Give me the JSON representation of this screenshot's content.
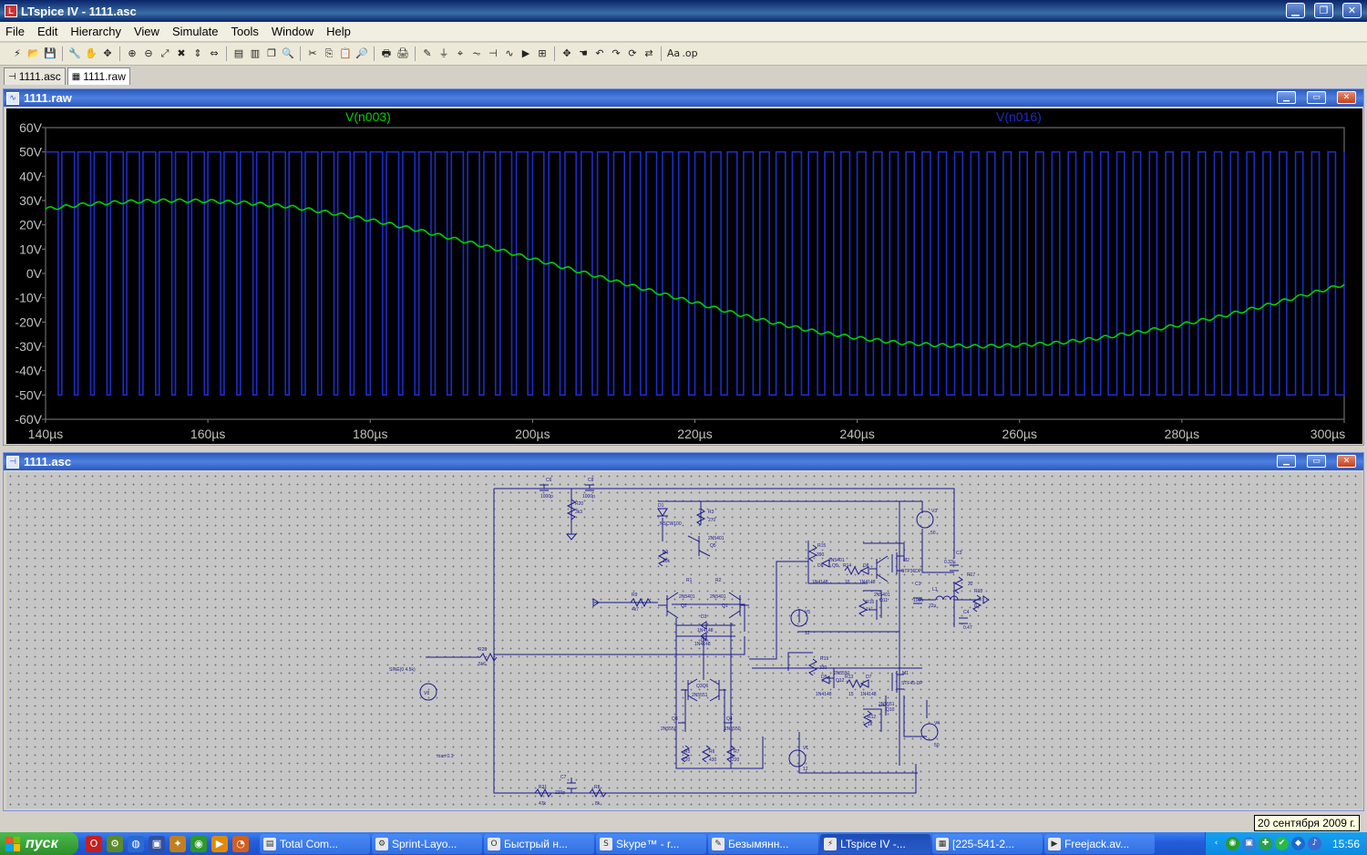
{
  "window": {
    "title": "LTspice IV - 1111.asc",
    "minimize": "▁",
    "restore": "❐",
    "close": "✕"
  },
  "menu": [
    "File",
    "Edit",
    "Hierarchy",
    "View",
    "Simulate",
    "Tools",
    "Window",
    "Help"
  ],
  "toolbar": {
    "icons": [
      "run-icon",
      "open-icon",
      "save-icon",
      "control-panel-icon",
      "halt-icon",
      "pan-icon",
      "zoom-in-icon",
      "zoom-out-icon",
      "zoom-full-icon",
      "zoom-cancel-icon",
      "autorange-icon",
      "measure-icon",
      "tile-horizontal-icon",
      "tile-vertical-icon",
      "cascade-icon",
      "find-icon",
      "cut-icon",
      "copy-icon",
      "paste-icon",
      "search-icon",
      "print-setup-icon",
      "print-icon",
      "wire-icon",
      "ground-icon",
      "label-icon",
      "resistor-icon",
      "capacitor-icon",
      "inductor-icon",
      "diode-icon",
      "component-icon",
      "move-icon",
      "drag-icon",
      "undo-icon",
      "redo-icon",
      "rotate-icon",
      "mirror-icon",
      "text-icon",
      "spice-directive-icon"
    ],
    "glyphs": [
      "⚡",
      "📂",
      "💾",
      "🔧",
      "✋",
      "✥",
      "⊕",
      "⊖",
      "⤢",
      "✖",
      "⇕",
      "⇔",
      "▤",
      "▥",
      "❐",
      "🔍",
      "✂",
      "⎘",
      "📋",
      "🔎",
      "🖶",
      "🖨",
      "✎",
      "⏚",
      "⌖",
      "⏦",
      "⊣",
      "∿",
      "▶",
      "⊞",
      "✥",
      "☚",
      "↶",
      "↷",
      "⟳",
      "⇄",
      "Aa",
      ".op"
    ]
  },
  "tabs": [
    {
      "label": "1111.asc",
      "icon": "schematic-tab-icon",
      "active": false
    },
    {
      "label": "1111.raw",
      "icon": "waveform-tab-icon",
      "active": true
    }
  ],
  "plot_window": {
    "title": "1111.raw",
    "trace1": {
      "name": "V(n003)",
      "color": "#00d000"
    },
    "trace2": {
      "name": "V(n016)",
      "color": "#1c2dc8"
    }
  },
  "chart_data": {
    "type": "line",
    "title": "",
    "xlabel": "",
    "ylabel": "",
    "xlim": [
      140,
      300
    ],
    "ylim": [
      -60,
      60
    ],
    "x_ticks": [
      "140µs",
      "160µs",
      "180µs",
      "200µs",
      "220µs",
      "240µs",
      "260µs",
      "280µs",
      "300µs"
    ],
    "y_ticks": [
      "60V",
      "50V",
      "40V",
      "30V",
      "20V",
      "10V",
      "0V",
      "-10V",
      "-20V",
      "-30V",
      "-40V",
      "-50V",
      "-60V"
    ],
    "grid": false,
    "legend": "top",
    "series": [
      {
        "name": "V(n003)",
        "color": "#00d000",
        "x_us": [
          140,
          145,
          150,
          155,
          160,
          165,
          170,
          175,
          180,
          185,
          190,
          195,
          200,
          205,
          210,
          215,
          220,
          225,
          230,
          235,
          240,
          245,
          250,
          255,
          260,
          265,
          270,
          275,
          280,
          285,
          290,
          295,
          300
        ],
        "y_v": [
          26.5,
          28.5,
          29.5,
          30,
          29.8,
          29,
          27.5,
          25,
          22,
          18.5,
          14.5,
          10.5,
          6,
          1.5,
          -3,
          -7.5,
          -12,
          -16.5,
          -20.5,
          -24,
          -26.5,
          -28.5,
          -29.5,
          -30,
          -29.5,
          -28.5,
          -26.5,
          -24,
          -21,
          -17.5,
          -13.5,
          -9,
          -4.5
        ]
      },
      {
        "name": "V(n016)",
        "color": "#1c2dc8",
        "type": "pwm-square",
        "high": 50,
        "low": -50,
        "cycles": 80,
        "duty_start": 0.78,
        "duty_end": 0.46
      }
    ]
  },
  "schematic_window": {
    "title": "1111.asc",
    "labels": {
      "c6": "C6",
      "c6v": "1000p",
      "c8": "C8",
      "c8v": "1000p",
      "r20": "R20",
      "r20v": "3k3",
      "d1": "D1",
      "d1v": "NSCW100",
      "r3": "R3",
      "r3v": "270",
      "q5": "2N5401",
      "q5n": "Q5",
      "r4": "R4",
      "r4v": "10k",
      "r1": "R1",
      "r2": "R2",
      "q2": "2N5401",
      "q2n": "Q2",
      "q1": "2N5401",
      "q1n": "Q1",
      "r9": "R9",
      "r9v": "4k7",
      "d3": "D3",
      "d3v": "1N4148",
      "d4": "D4",
      "d4v": "1N4148",
      "r26": "R26",
      "r26v": "5k6",
      "v8src": "SINE(0 4.5k)",
      "v8": "V8",
      "q3q6": "Q3Q6",
      "q3q6v": "2N5551",
      "q8": "Q8",
      "q8v": "2N5550",
      "q4": "Q4",
      "q4v": "2N5550",
      "r5": "R5",
      "r5v": "220",
      "r6": "R6",
      "r6v": "430",
      "r7": "R7",
      "r7v": "220",
      "tran": ".tran 0.1",
      "c7": "C7",
      "c7v": "220p",
      "r21": "R21",
      "r21v": "47k",
      "r8": "R8",
      "r8v": "8k",
      "r15": "R15",
      "r15v": "390",
      "q9": "2N5401",
      "q9n": "Q9",
      "d6": "D6",
      "d6v": "1N4148",
      "r14": "R14",
      "r14v": "15",
      "d8": "D8",
      "d8v": "1N4148",
      "m2": "M2",
      "m2v": "STP36DP",
      "r16": "R16",
      "r16v": "1k",
      "q11": "2N5401",
      "q11n": "Q11",
      "c1": "C1",
      "c1v": "100n",
      "l1": "L1",
      "l1v": "22µ",
      "c3": "C3",
      "c3v": "0.33µ",
      "r17": "R17",
      "r17v": "22",
      "r18": "R18",
      "r18v": "8",
      "c4": "C4",
      "c4v": "0.47",
      "v3": "V3",
      "v3v": "50",
      "v5": "V5",
      "v5v": "12",
      "r19": "R19",
      "r19v": "330",
      "q12": "2N5551",
      "q12n": "Q12",
      "d5": "D5",
      "d5v": "1N4148",
      "r13": "R13",
      "r13v": "15",
      "d7": "D7",
      "d7v": "1N4148",
      "m1": "M1",
      "m1v": "STF45-DP",
      "q10": "2N5551",
      "q10n": "Q10",
      "r12": "R12",
      "r12v": "1k",
      "v4": "V4",
      "v4v": "50",
      "v1": "V1",
      "v1v": "12"
    }
  },
  "tooltip": "20 сентября 2009 г.",
  "taskbar": {
    "start": "пуск",
    "quicklaunch": [
      {
        "icon": "opera-icon",
        "glyph": "O",
        "color": "#c81e1e"
      },
      {
        "icon": "tool-icon",
        "glyph": "⚙",
        "color": "#5a8a2a"
      },
      {
        "icon": "globe-icon",
        "glyph": "◍",
        "color": "#2a6ad0"
      },
      {
        "icon": "disk-icon",
        "glyph": "▣",
        "color": "#3050a0"
      },
      {
        "icon": "wand-icon",
        "glyph": "✦",
        "color": "#c08020"
      },
      {
        "icon": "green-app-icon",
        "glyph": "◉",
        "color": "#2a9a2a"
      },
      {
        "icon": "player-icon",
        "glyph": "▶",
        "color": "#e08a00"
      },
      {
        "icon": "firefox-icon",
        "glyph": "◔",
        "color": "#d06020"
      }
    ],
    "tasks": [
      {
        "label": "Total Com...",
        "glyph": "▤",
        "active": false
      },
      {
        "label": "Sprint-Layo...",
        "glyph": "⚙",
        "active": false
      },
      {
        "label": "Быстрый н...",
        "glyph": "O",
        "active": false
      },
      {
        "label": "Skype™ - r...",
        "glyph": "S",
        "active": false
      },
      {
        "label": "Безымянн...",
        "glyph": "✎",
        "active": false
      },
      {
        "label": "LTspice IV -...",
        "glyph": "⚡",
        "active": true
      },
      {
        "label": "[225-541-2...",
        "glyph": "▦",
        "active": false
      },
      {
        "label": "Freejack.av...",
        "glyph": "▶",
        "active": false
      }
    ],
    "tray": [
      {
        "icon": "tray-arrow-icon",
        "glyph": "‹",
        "color": "transparent"
      },
      {
        "icon": "tray-green-icon",
        "glyph": "◉",
        "color": "#2a9a2a"
      },
      {
        "icon": "tray-network-icon",
        "glyph": "▣",
        "color": "#3a7ad0"
      },
      {
        "icon": "tray-antivirus-icon",
        "glyph": "✚",
        "color": "#2aa04a"
      },
      {
        "icon": "tray-skype-icon",
        "glyph": "✔",
        "color": "#2ab84a"
      },
      {
        "icon": "tray-shield-icon",
        "glyph": "◆",
        "color": "#1a6ad0"
      },
      {
        "icon": "tray-volume-icon",
        "glyph": "♪",
        "color": "#3a6ad0"
      }
    ],
    "clock": "15:56"
  }
}
